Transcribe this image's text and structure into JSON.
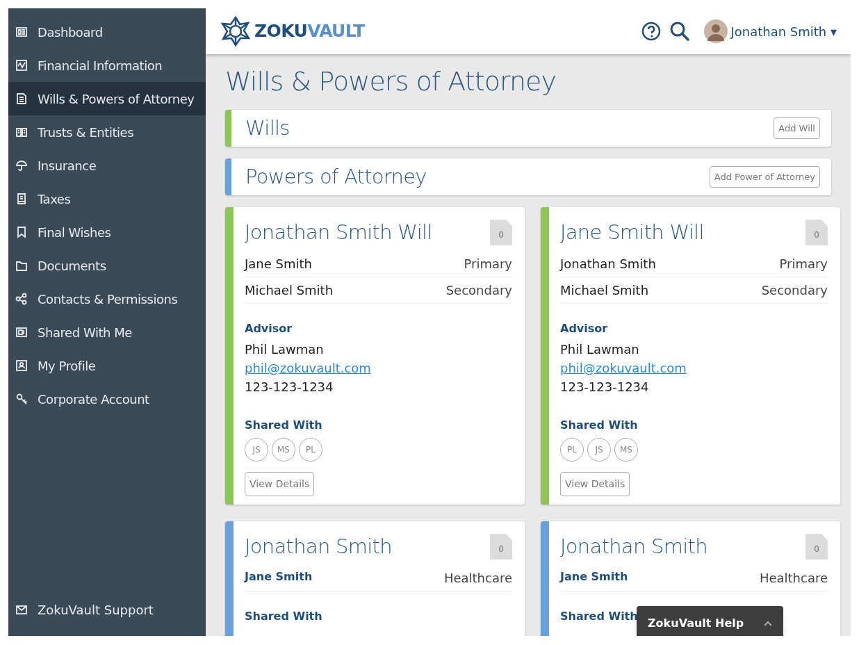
{
  "sidebar": {
    "items": [
      {
        "label": "Dashboard",
        "selected": false
      },
      {
        "label": "Financial Information",
        "selected": false
      },
      {
        "label": "Wills & Powers of Attorney",
        "selected": true
      },
      {
        "label": "Trusts & Entities",
        "selected": false
      },
      {
        "label": "Insurance",
        "selected": false
      },
      {
        "label": "Taxes",
        "selected": false
      },
      {
        "label": "Final Wishes",
        "selected": false
      },
      {
        "label": "Documents",
        "selected": false
      },
      {
        "label": "Contacts & Permissions",
        "selected": false
      },
      {
        "label": "Shared With Me",
        "selected": false
      },
      {
        "label": "My Profile",
        "selected": false
      },
      {
        "label": "Corporate Account",
        "selected": false
      }
    ],
    "support": {
      "label": "ZokuVault Support"
    }
  },
  "header": {
    "logo": {
      "part_1": "ZOKU",
      "part_2": "VAULT"
    },
    "user": {
      "name": "Jonathan Smith",
      "caret": "▾"
    }
  },
  "page_title": "Wills & Powers of Attorney",
  "sections": [
    {
      "title": "Wills",
      "button": "Add Will",
      "color": "#8dc657"
    },
    {
      "title": "Powers of Attorney",
      "button": "Add Power of Attorney",
      "color": "#6a9fd8"
    }
  ],
  "cards": [
    {
      "title": "Jonathan Smith Will",
      "color": "#8dc657",
      "doc_count": "0",
      "kind": "will",
      "rows": [
        {
          "name": "Jane Smith",
          "role": "Primary"
        },
        {
          "name": "Michael Smith",
          "role": "Secondary"
        }
      ],
      "advisor_label": "Advisor",
      "advisor": {
        "name": "Phil Lawman",
        "email": "phil@zokuvault.com",
        "phone": "123-123-1234"
      },
      "shared_label": "Shared With",
      "shared_with": [
        "JS",
        "MS",
        "PL"
      ],
      "button": "View Details"
    },
    {
      "title": "Jane Smith Will",
      "color": "#8dc657",
      "doc_count": "0",
      "kind": "will",
      "rows": [
        {
          "name": "Jonathan Smith",
          "role": "Primary"
        },
        {
          "name": "Michael Smith",
          "role": "Secondary"
        }
      ],
      "advisor_label": "Advisor",
      "advisor": {
        "name": "Phil Lawman",
        "email": "phil@zokuvault.com",
        "phone": "123-123-1234"
      },
      "shared_label": "Shared With",
      "shared_with": [
        "PL",
        "JS",
        "MS"
      ],
      "button": "View Details"
    },
    {
      "title": "Jonathan Smith",
      "color": "#6a9fd8",
      "doc_count": "0",
      "kind": "poa",
      "rows": [
        {
          "name": "Jane Smith",
          "role": "Healthcare"
        }
      ],
      "shared_label": "Shared With"
    },
    {
      "title": "Jonathan Smith",
      "color": "#6a9fd8",
      "doc_count": "0",
      "kind": "poa",
      "rows": [
        {
          "name": "Jane Smith",
          "role": "Healthcare"
        }
      ],
      "shared_label": "Shared With"
    }
  ],
  "help_widget": {
    "label": "ZokuVault Help"
  }
}
